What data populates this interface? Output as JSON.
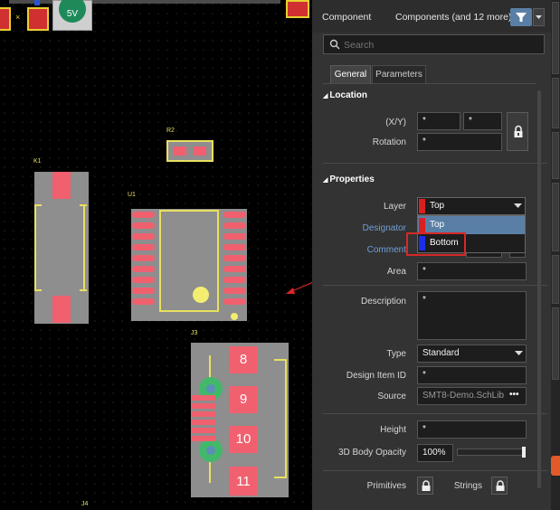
{
  "canvas": {
    "silkscreen": {
      "r2": "R2",
      "k1": "K1",
      "u1": "U1",
      "j3": "J3",
      "j4": "J4"
    },
    "top_part_label": "5V",
    "j3_pins": [
      "8",
      "9",
      "10",
      "11"
    ]
  },
  "panel": {
    "kind": "Component",
    "filter_text": "Components (and 12 more)",
    "search_placeholder": "Search",
    "tabs": [
      "General",
      "Parameters"
    ],
    "location": {
      "title": "Location",
      "xy_label": "(X/Y)",
      "x_value": "*",
      "y_value": "*",
      "rotation_label": "Rotation",
      "rotation_value": "*"
    },
    "properties": {
      "title": "Properties",
      "layer_label": "Layer",
      "layer_value": "Top",
      "layer_options": [
        "Top",
        "Bottom"
      ],
      "designator_label": "Designator",
      "comment_label": "Comment",
      "area_label": "Area",
      "area_value": "*",
      "description_label": "Description",
      "description_value": "*",
      "type_label": "Type",
      "type_value": "Standard",
      "design_item_label": "Design Item ID",
      "design_item_value": "*",
      "source_label": "Source",
      "source_value": "SMT8-Demo.SchLib",
      "height_label": "Height",
      "height_value": "*",
      "opacity_label": "3D Body Opacity",
      "opacity_value": "100%",
      "opacity_level": 1.0,
      "primitives_label": "Primitives",
      "strings_label": "Strings"
    }
  },
  "colors": {
    "top_layer": "#d92020",
    "bottom_layer": "#1a2ee8",
    "accent": "#5a7fa6",
    "highlight": "#d62828"
  }
}
